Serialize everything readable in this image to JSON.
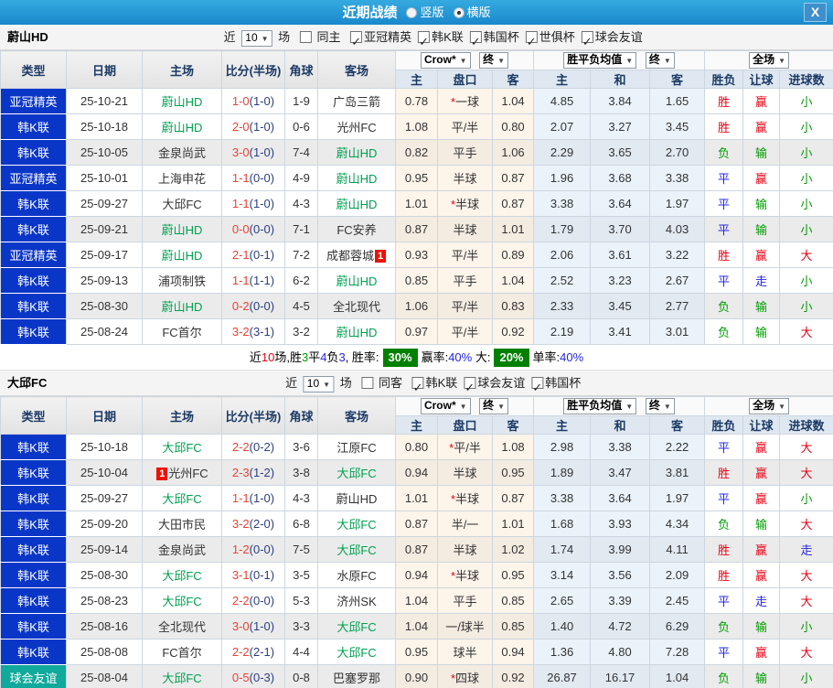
{
  "titlebar": {
    "title": "近期战绩",
    "radio_vertical": "竖版",
    "radio_horizontal": "横版",
    "close": "X"
  },
  "columns": {
    "main": [
      "类型",
      "日期",
      "主场",
      "比分(半场)",
      "角球",
      "客场"
    ],
    "sub": [
      "主",
      "盘口",
      "客",
      "主",
      "和",
      "客",
      "胜负",
      "让球",
      "进球数"
    ]
  },
  "dropdowns": {
    "bookmaker": "Crow*",
    "final1": "终",
    "avg": "胜平负均值",
    "final2": "终",
    "scope": "全场"
  },
  "sections": [
    {
      "team": "蔚山HD",
      "controls": {
        "recent": "近",
        "count": "10",
        "matches": "场",
        "same_label": "同主",
        "leagues": [
          "亚冠精英",
          "韩K联",
          "韩国杯",
          "世俱杯",
          "球会友谊"
        ]
      },
      "rows": [
        {
          "type": "亚冠精英",
          "type_style": "blue",
          "shade": false,
          "date": "25-10-21",
          "home": "蔚山HD",
          "home_focus": true,
          "home_badge": "",
          "score": "1-0",
          "half": "(1-0)",
          "corner": "1-9",
          "away": "广岛三箭",
          "away_focus": false,
          "away_badge": "",
          "star": "*",
          "handicap": "一球",
          "odds_home": "0.78",
          "odds_away": "1.04",
          "eur_home": "4.85",
          "eur_draw": "3.84",
          "eur_away": "1.65",
          "wdl": "胜",
          "wdl_c": "red",
          "hcp": "赢",
          "hcp_c": "red",
          "goals": "小",
          "goals_c": "green"
        },
        {
          "type": "韩K联",
          "type_style": "blue",
          "shade": false,
          "date": "25-10-18",
          "home": "蔚山HD",
          "home_focus": true,
          "home_badge": "",
          "score": "2-0",
          "half": "(1-0)",
          "corner": "0-6",
          "away": "光州FC",
          "away_focus": false,
          "away_badge": "",
          "star": "",
          "handicap": "平/半",
          "odds_home": "1.08",
          "odds_away": "0.80",
          "eur_home": "2.07",
          "eur_draw": "3.27",
          "eur_away": "3.45",
          "wdl": "胜",
          "wdl_c": "red",
          "hcp": "赢",
          "hcp_c": "red",
          "goals": "小",
          "goals_c": "green"
        },
        {
          "type": "韩K联",
          "type_style": "blue",
          "shade": true,
          "date": "25-10-05",
          "home": "金泉尚武",
          "home_focus": false,
          "home_badge": "",
          "score": "3-0",
          "half": "(1-0)",
          "corner": "7-4",
          "away": "蔚山HD",
          "away_focus": true,
          "away_badge": "",
          "star": "",
          "handicap": "平手",
          "odds_home": "0.82",
          "odds_away": "1.06",
          "eur_home": "2.29",
          "eur_draw": "3.65",
          "eur_away": "2.70",
          "wdl": "负",
          "wdl_c": "green",
          "hcp": "输",
          "hcp_c": "green",
          "goals": "小",
          "goals_c": "green"
        },
        {
          "type": "亚冠精英",
          "type_style": "blue",
          "shade": false,
          "date": "25-10-01",
          "home": "上海申花",
          "home_focus": false,
          "home_badge": "",
          "score": "1-1",
          "half": "(0-0)",
          "corner": "4-9",
          "away": "蔚山HD",
          "away_focus": true,
          "away_badge": "",
          "star": "",
          "handicap": "半球",
          "odds_home": "0.95",
          "odds_away": "0.87",
          "eur_home": "1.96",
          "eur_draw": "3.68",
          "eur_away": "3.38",
          "wdl": "平",
          "wdl_c": "blue",
          "hcp": "赢",
          "hcp_c": "red",
          "goals": "小",
          "goals_c": "green"
        },
        {
          "type": "韩K联",
          "type_style": "blue",
          "shade": false,
          "date": "25-09-27",
          "home": "大邱FC",
          "home_focus": false,
          "home_badge": "",
          "score": "1-1",
          "half": "(1-0)",
          "corner": "4-3",
          "away": "蔚山HD",
          "away_focus": true,
          "away_badge": "",
          "star": "*",
          "handicap": "半球",
          "odds_home": "1.01",
          "odds_away": "0.87",
          "eur_home": "3.38",
          "eur_draw": "3.64",
          "eur_away": "1.97",
          "wdl": "平",
          "wdl_c": "blue",
          "hcp": "输",
          "hcp_c": "green",
          "goals": "小",
          "goals_c": "green"
        },
        {
          "type": "韩K联",
          "type_style": "blue",
          "shade": true,
          "date": "25-09-21",
          "home": "蔚山HD",
          "home_focus": true,
          "home_badge": "",
          "score": "0-0",
          "half": "(0-0)",
          "corner": "7-1",
          "away": "FC安养",
          "away_focus": false,
          "away_badge": "",
          "star": "",
          "handicap": "半球",
          "odds_home": "0.87",
          "odds_away": "1.01",
          "eur_home": "1.79",
          "eur_draw": "3.70",
          "eur_away": "4.03",
          "wdl": "平",
          "wdl_c": "blue",
          "hcp": "输",
          "hcp_c": "green",
          "goals": "小",
          "goals_c": "green"
        },
        {
          "type": "亚冠精英",
          "type_style": "blue",
          "shade": false,
          "date": "25-09-17",
          "home": "蔚山HD",
          "home_focus": true,
          "home_badge": "",
          "score": "2-1",
          "half": "(0-1)",
          "corner": "7-2",
          "away": "成都蓉城",
          "away_focus": false,
          "away_badge": "1",
          "star": "",
          "handicap": "平/半",
          "odds_home": "0.93",
          "odds_away": "0.89",
          "eur_home": "2.06",
          "eur_draw": "3.61",
          "eur_away": "3.22",
          "wdl": "胜",
          "wdl_c": "red",
          "hcp": "赢",
          "hcp_c": "red",
          "goals": "大",
          "goals_c": "red"
        },
        {
          "type": "韩K联",
          "type_style": "blue",
          "shade": false,
          "date": "25-09-13",
          "home": "浦项制铁",
          "home_focus": false,
          "home_badge": "",
          "score": "1-1",
          "half": "(1-1)",
          "corner": "6-2",
          "away": "蔚山HD",
          "away_focus": true,
          "away_badge": "",
          "star": "",
          "handicap": "平手",
          "odds_home": "0.85",
          "odds_away": "1.04",
          "eur_home": "2.52",
          "eur_draw": "3.23",
          "eur_away": "2.67",
          "wdl": "平",
          "wdl_c": "blue",
          "hcp": "走",
          "hcp_c": "blue",
          "goals": "小",
          "goals_c": "green"
        },
        {
          "type": "韩K联",
          "type_style": "blue",
          "shade": true,
          "date": "25-08-30",
          "home": "蔚山HD",
          "home_focus": true,
          "home_badge": "",
          "score": "0-2",
          "half": "(0-0)",
          "corner": "4-5",
          "away": "全北现代",
          "away_focus": false,
          "away_badge": "",
          "star": "",
          "handicap": "平/半",
          "odds_home": "1.06",
          "odds_away": "0.83",
          "eur_home": "2.33",
          "eur_draw": "3.45",
          "eur_away": "2.77",
          "wdl": "负",
          "wdl_c": "green",
          "hcp": "输",
          "hcp_c": "green",
          "goals": "小",
          "goals_c": "green"
        },
        {
          "type": "韩K联",
          "type_style": "blue",
          "shade": false,
          "date": "25-08-24",
          "home": "FC首尔",
          "home_focus": false,
          "home_badge": "",
          "score": "3-2",
          "half": "(3-1)",
          "corner": "3-2",
          "away": "蔚山HD",
          "away_focus": true,
          "away_badge": "",
          "star": "",
          "handicap": "平/半",
          "odds_home": "0.97",
          "odds_away": "0.92",
          "eur_home": "2.19",
          "eur_draw": "3.41",
          "eur_away": "3.01",
          "wdl": "负",
          "wdl_c": "green",
          "hcp": "输",
          "hcp_c": "green",
          "goals": "大",
          "goals_c": "red"
        }
      ],
      "summary": {
        "seg1": "近",
        "seg2": "10",
        "seg3": "场,胜",
        "seg4": "3",
        "seg5": "平",
        "seg6": "4",
        "seg7": "负",
        "seg8": "3",
        "seg9": ", 胜率:",
        "win_rate": "30%",
        "seg10": "赢率:",
        "hcp_rate": "40%",
        "seg11": "大:",
        "big_rate": "20%",
        "seg12": "单率:",
        "odd_rate": "40%"
      }
    },
    {
      "team": "大邱FC",
      "controls": {
        "recent": "近",
        "count": "10",
        "matches": "场",
        "same_label": "同客",
        "leagues": [
          "韩K联",
          "球会友谊",
          "韩国杯"
        ]
      },
      "rows": [
        {
          "type": "韩K联",
          "type_style": "blue",
          "shade": false,
          "date": "25-10-18",
          "home": "大邱FC",
          "home_focus": true,
          "home_badge": "",
          "score": "2-2",
          "half": "(0-2)",
          "corner": "3-6",
          "away": "江原FC",
          "away_focus": false,
          "away_badge": "",
          "star": "*",
          "handicap": "平/半",
          "odds_home": "0.80",
          "odds_away": "1.08",
          "eur_home": "2.98",
          "eur_draw": "3.38",
          "eur_away": "2.22",
          "wdl": "平",
          "wdl_c": "blue",
          "hcp": "赢",
          "hcp_c": "red",
          "goals": "大",
          "goals_c": "red"
        },
        {
          "type": "韩K联",
          "type_style": "blue",
          "shade": true,
          "date": "25-10-04",
          "home": "光州FC",
          "home_focus": false,
          "home_badge": "1",
          "score": "2-3",
          "half": "(1-2)",
          "corner": "3-8",
          "away": "大邱FC",
          "away_focus": true,
          "away_badge": "",
          "star": "",
          "handicap": "半球",
          "odds_home": "0.94",
          "odds_away": "0.95",
          "eur_home": "1.89",
          "eur_draw": "3.47",
          "eur_away": "3.81",
          "wdl": "胜",
          "wdl_c": "red",
          "hcp": "赢",
          "hcp_c": "red",
          "goals": "大",
          "goals_c": "red"
        },
        {
          "type": "韩K联",
          "type_style": "blue",
          "shade": false,
          "date": "25-09-27",
          "home": "大邱FC",
          "home_focus": true,
          "home_badge": "",
          "score": "1-1",
          "half": "(1-0)",
          "corner": "4-3",
          "away": "蔚山HD",
          "away_focus": false,
          "away_badge": "",
          "star": "*",
          "handicap": "半球",
          "odds_home": "1.01",
          "odds_away": "0.87",
          "eur_home": "3.38",
          "eur_draw": "3.64",
          "eur_away": "1.97",
          "wdl": "平",
          "wdl_c": "blue",
          "hcp": "赢",
          "hcp_c": "red",
          "goals": "小",
          "goals_c": "green"
        },
        {
          "type": "韩K联",
          "type_style": "blue",
          "shade": false,
          "date": "25-09-20",
          "home": "大田市民",
          "home_focus": false,
          "home_badge": "",
          "score": "3-2",
          "half": "(2-0)",
          "corner": "6-8",
          "away": "大邱FC",
          "away_focus": true,
          "away_badge": "",
          "star": "",
          "handicap": "半/一",
          "odds_home": "0.87",
          "odds_away": "1.01",
          "eur_home": "1.68",
          "eur_draw": "3.93",
          "eur_away": "4.34",
          "wdl": "负",
          "wdl_c": "green",
          "hcp": "输",
          "hcp_c": "green",
          "goals": "大",
          "goals_c": "red"
        },
        {
          "type": "韩K联",
          "type_style": "blue",
          "shade": true,
          "date": "25-09-14",
          "home": "金泉尚武",
          "home_focus": false,
          "home_badge": "",
          "score": "1-2",
          "half": "(0-0)",
          "corner": "7-5",
          "away": "大邱FC",
          "away_focus": true,
          "away_badge": "",
          "star": "",
          "handicap": "半球",
          "odds_home": "0.87",
          "odds_away": "1.02",
          "eur_home": "1.74",
          "eur_draw": "3.99",
          "eur_away": "4.11",
          "wdl": "胜",
          "wdl_c": "red",
          "hcp": "赢",
          "hcp_c": "red",
          "goals": "走",
          "goals_c": "blue"
        },
        {
          "type": "韩K联",
          "type_style": "blue",
          "shade": false,
          "date": "25-08-30",
          "home": "大邱FC",
          "home_focus": true,
          "home_badge": "",
          "score": "3-1",
          "half": "(0-1)",
          "corner": "3-5",
          "away": "水原FC",
          "away_focus": false,
          "away_badge": "",
          "star": "*",
          "handicap": "半球",
          "odds_home": "0.94",
          "odds_away": "0.95",
          "eur_home": "3.14",
          "eur_draw": "3.56",
          "eur_away": "2.09",
          "wdl": "胜",
          "wdl_c": "red",
          "hcp": "赢",
          "hcp_c": "red",
          "goals": "大",
          "goals_c": "red"
        },
        {
          "type": "韩K联",
          "type_style": "blue",
          "shade": false,
          "date": "25-08-23",
          "home": "大邱FC",
          "home_focus": true,
          "home_badge": "",
          "score": "2-2",
          "half": "(0-0)",
          "corner": "5-3",
          "away": "济州SK",
          "away_focus": false,
          "away_badge": "",
          "star": "",
          "handicap": "平手",
          "odds_home": "1.04",
          "odds_away": "0.85",
          "eur_home": "2.65",
          "eur_draw": "3.39",
          "eur_away": "2.45",
          "wdl": "平",
          "wdl_c": "blue",
          "hcp": "走",
          "hcp_c": "blue",
          "goals": "大",
          "goals_c": "red"
        },
        {
          "type": "韩K联",
          "type_style": "blue",
          "shade": true,
          "date": "25-08-16",
          "home": "全北现代",
          "home_focus": false,
          "home_badge": "",
          "score": "3-0",
          "half": "(1-0)",
          "corner": "3-3",
          "away": "大邱FC",
          "away_focus": true,
          "away_badge": "",
          "star": "",
          "handicap": "一/球半",
          "odds_home": "1.04",
          "odds_away": "0.85",
          "eur_home": "1.40",
          "eur_draw": "4.72",
          "eur_away": "6.29",
          "wdl": "负",
          "wdl_c": "green",
          "hcp": "输",
          "hcp_c": "green",
          "goals": "小",
          "goals_c": "green"
        },
        {
          "type": "韩K联",
          "type_style": "blue",
          "shade": false,
          "date": "25-08-08",
          "home": "FC首尔",
          "home_focus": false,
          "home_badge": "",
          "score": "2-2",
          "half": "(2-1)",
          "corner": "4-4",
          "away": "大邱FC",
          "away_focus": true,
          "away_badge": "",
          "star": "",
          "handicap": "球半",
          "odds_home": "0.95",
          "odds_away": "0.94",
          "eur_home": "1.36",
          "eur_draw": "4.80",
          "eur_away": "7.28",
          "wdl": "平",
          "wdl_c": "blue",
          "hcp": "赢",
          "hcp_c": "red",
          "goals": "大",
          "goals_c": "red"
        },
        {
          "type": "球会友谊",
          "type_style": "teal",
          "shade": true,
          "date": "25-08-04",
          "home": "大邱FC",
          "home_focus": true,
          "home_badge": "",
          "score": "0-5",
          "half": "(0-3)",
          "corner": "0-8",
          "away": "巴塞罗那",
          "away_focus": false,
          "away_badge": "",
          "star": "*",
          "handicap": "四球",
          "odds_home": "0.90",
          "odds_away": "0.92",
          "eur_home": "26.87",
          "eur_draw": "16.17",
          "eur_away": "1.04",
          "wdl": "负",
          "wdl_c": "green",
          "hcp": "输",
          "hcp_c": "green",
          "goals": "小",
          "goals_c": "green"
        }
      ]
    }
  ]
}
